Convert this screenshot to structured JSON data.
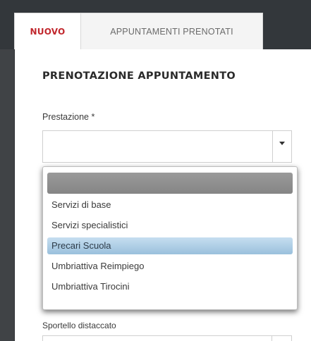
{
  "tabs": [
    {
      "label": "NUOVO",
      "active": true
    },
    {
      "label": "APPUNTAMENTI PRENOTATI",
      "active": false
    }
  ],
  "form": {
    "heading": "PRENOTAZIONE APPUNTAMENTO",
    "prestazione_label": "Prestazione *",
    "prestazione_value": "",
    "sportello_label": "Sportello distaccato"
  },
  "dropdown": {
    "options": [
      "",
      "Servizi di base",
      "Servizi specialistici",
      "Precari Scuola",
      "Umbriattiva Reimpiego",
      "Umbriattiva Tirocini"
    ],
    "highlighted_index": 3
  },
  "colors": {
    "active_tab_text": "#c1272d",
    "highlight": "#9ac0dc",
    "background_dark": "#33373b"
  }
}
